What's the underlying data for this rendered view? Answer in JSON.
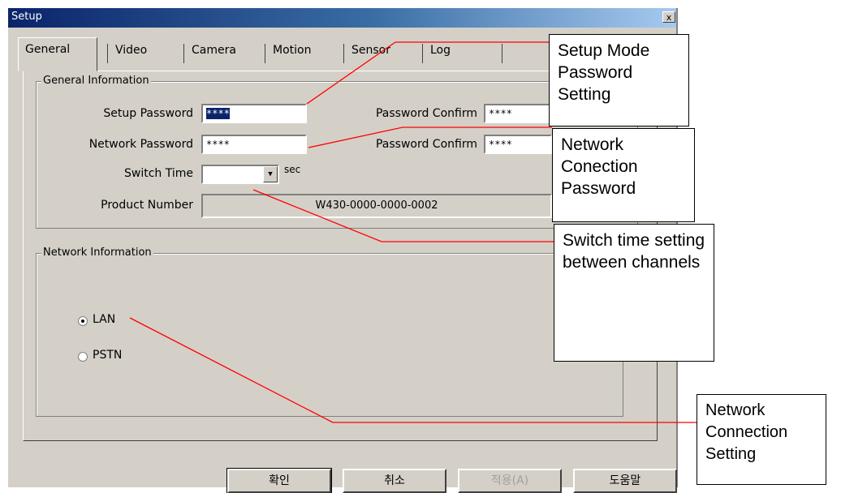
{
  "window": {
    "title": "Setup",
    "close_label": "x"
  },
  "tabs": [
    "General",
    "Video",
    "Camera",
    "Motion",
    "Sensor",
    "Log"
  ],
  "general_info": {
    "group_label": "General Information",
    "setup_password_label": "Setup Password",
    "setup_password_value": "****",
    "network_password_label": "Network Password",
    "network_password_value": "****",
    "password_confirm_label": "Password Confirm",
    "password_confirm_1_value": "****",
    "password_confirm_2_value": "****",
    "switch_time_label": "Switch Time",
    "switch_time_value": "",
    "switch_time_unit": "sec",
    "product_number_label": "Product Number",
    "product_number_value": "W430-0000-0000-0002"
  },
  "network_info": {
    "group_label": "Network Information",
    "options": [
      {
        "label": "LAN",
        "checked": true
      },
      {
        "label": "PSTN",
        "checked": false
      }
    ]
  },
  "buttons": {
    "ok": "확인",
    "cancel": "취소",
    "apply": "적용(A)",
    "help": "도움말"
  },
  "callouts": {
    "setup_mode": "Setup Mode Password Setting",
    "network_password": "Network Conection Password",
    "switch_time": "Switch time setting between channels",
    "network_connection": "Network Connection Setting"
  }
}
